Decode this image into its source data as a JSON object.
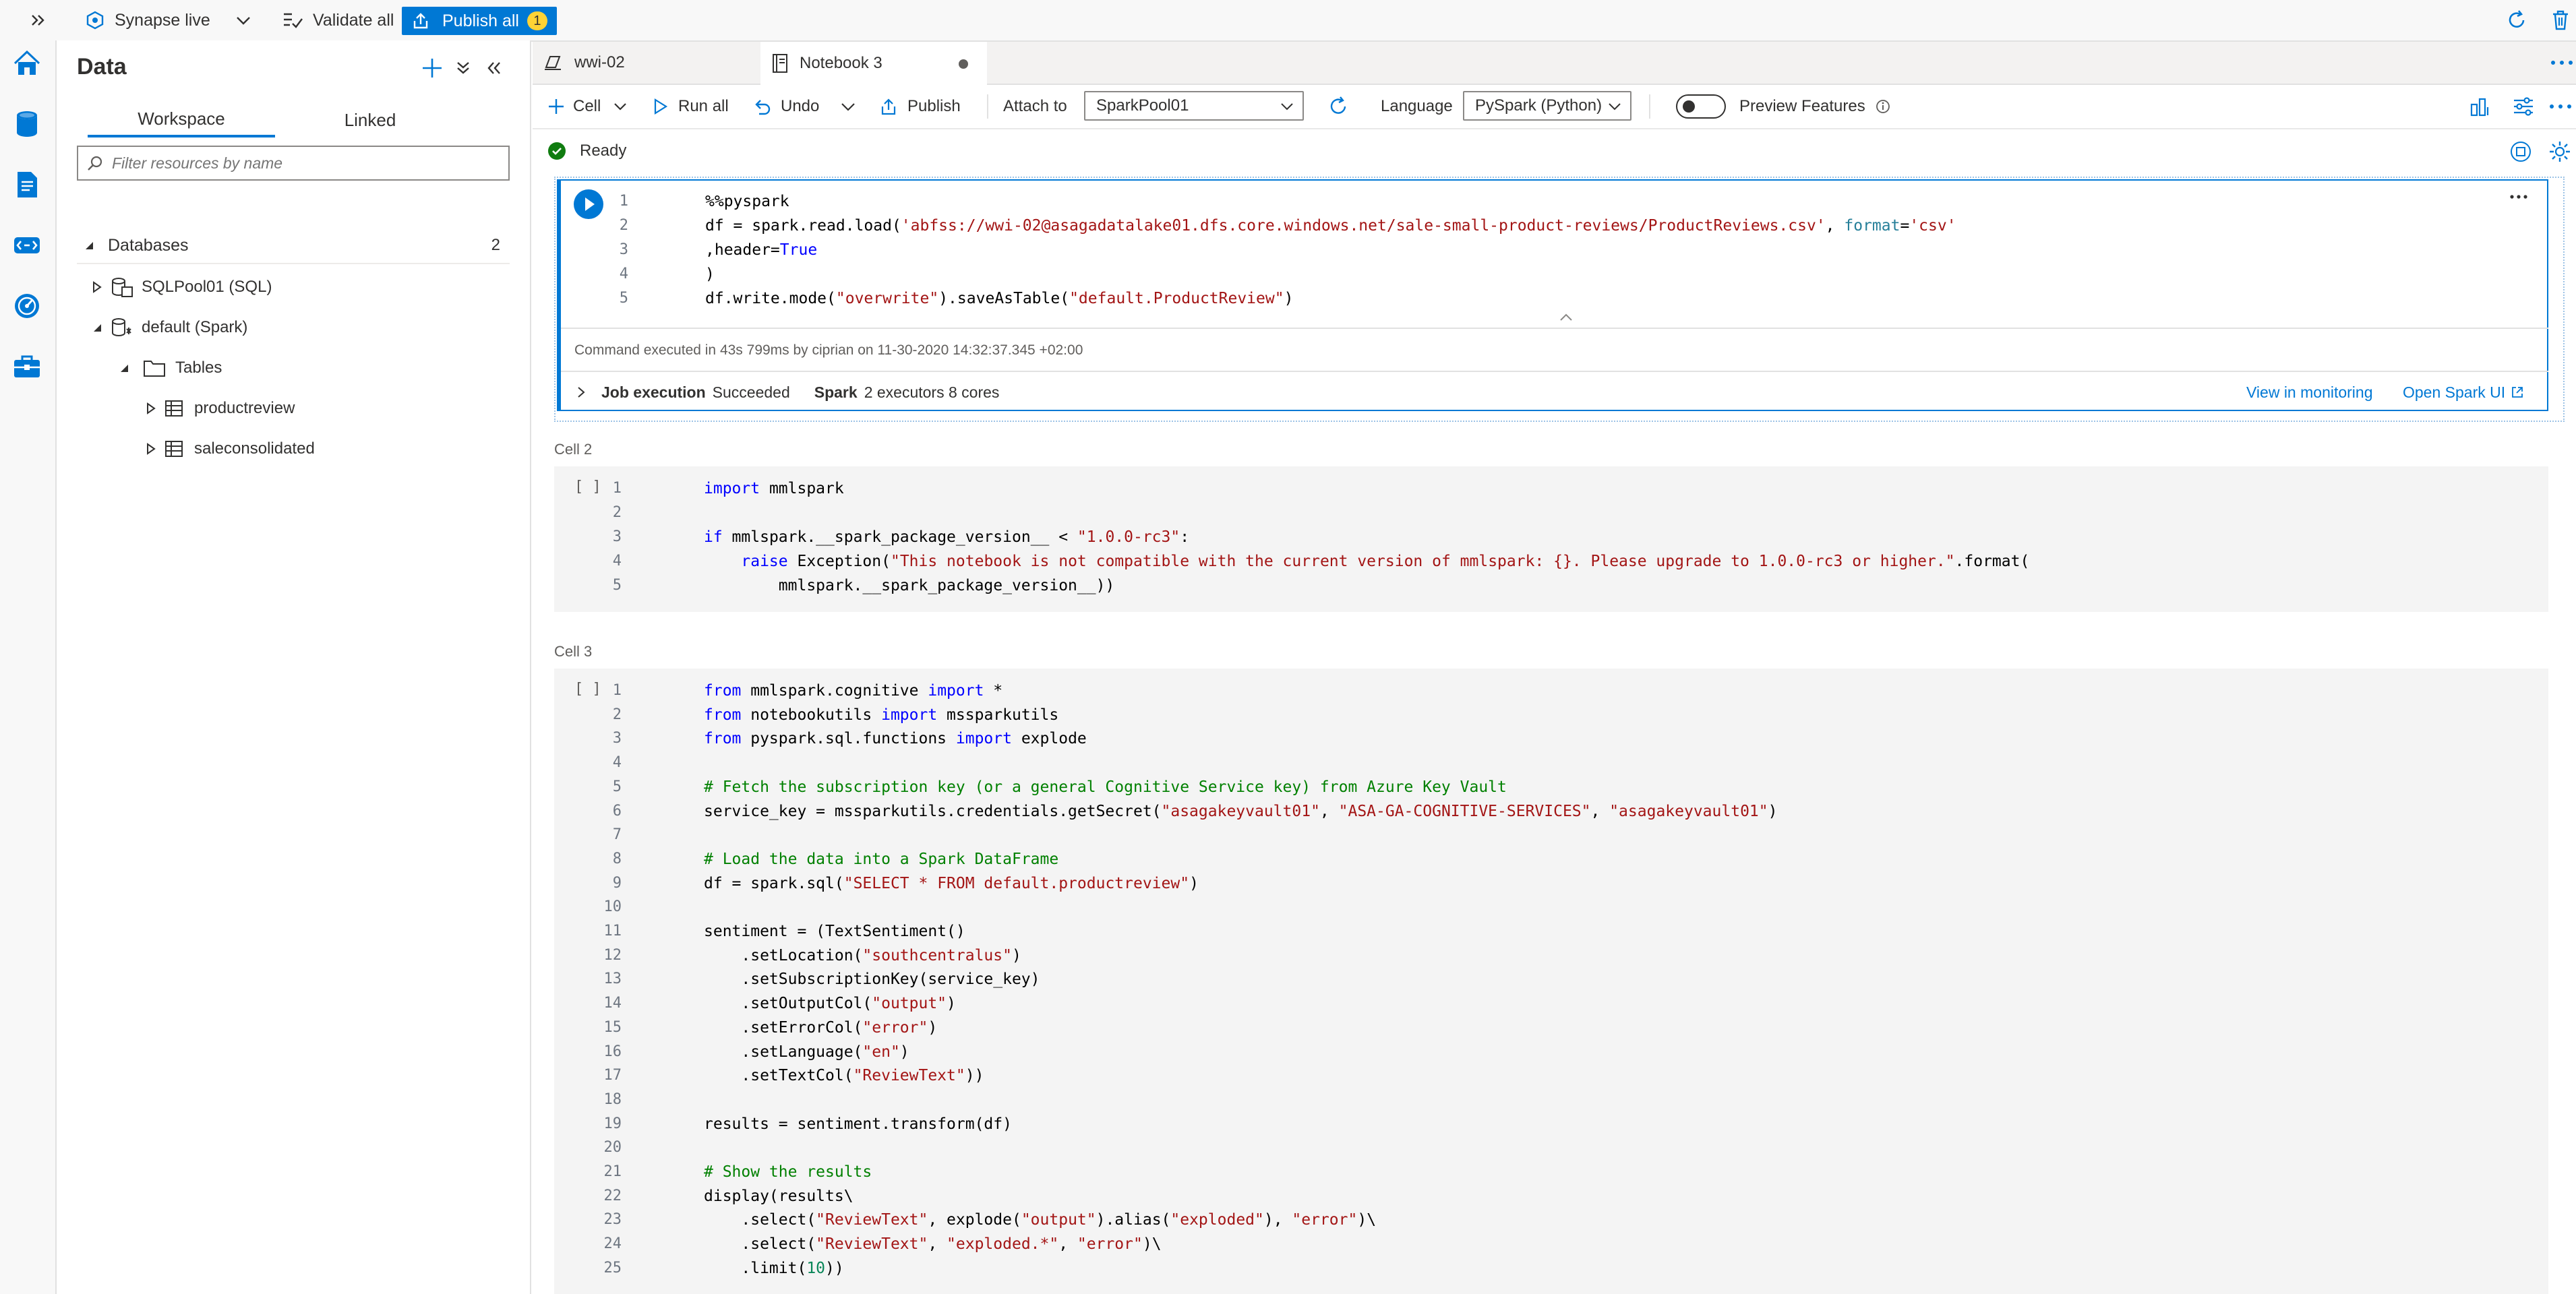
{
  "topbar": {
    "mode_label": "Synapse live",
    "validate_label": "Validate all",
    "publish_label": "Publish all",
    "publish_count": "1"
  },
  "data_panel": {
    "title": "Data",
    "tabs": [
      "Workspace",
      "Linked"
    ],
    "filter_placeholder": "Filter resources by name",
    "databases_label": "Databases",
    "databases_count": "2",
    "tree": [
      {
        "label": "SQLPool01 (SQL)"
      },
      {
        "label": "default (Spark)"
      },
      {
        "label": "Tables"
      },
      {
        "label": "productreview"
      },
      {
        "label": "saleconsolidated"
      }
    ]
  },
  "notebook": {
    "tabs": [
      {
        "label": "wwi-02"
      },
      {
        "label": "Notebook 3"
      }
    ],
    "toolbar": {
      "cell_label": "Cell",
      "run_all_label": "Run all",
      "undo_label": "Undo",
      "publish_label": "Publish",
      "attach_to_label": "Attach to",
      "attach_to_value": "SparkPool01",
      "language_label": "Language",
      "language_value": "PySpark (Python)",
      "preview_label": "Preview Features"
    },
    "status": "Ready",
    "cell1": {
      "lines": [
        "%%pyspark",
        "df = spark.read.load('abfss://wwi-02@asagadatalake01.dfs.core.windows.net/sale-small-product-reviews/ProductReviews.csv', format='csv'",
        ",header=True",
        ")",
        "df.write.mode(\"overwrite\").saveAsTable(\"default.ProductReview\")"
      ],
      "exec_info": "Command executed in 43s 799ms by ciprian on 11-30-2020 14:32:37.345 +02:00",
      "job_label": "Job execution",
      "job_status": "Succeeded",
      "spark_label": "Spark",
      "spark_info": "2 executors 8 cores",
      "view_monitoring": "View in monitoring",
      "open_spark_ui": "Open Spark UI"
    },
    "cell2": {
      "label": "Cell 2",
      "prompt": "[ ]",
      "lines": [
        "import mmlspark",
        "",
        "if mmlspark.__spark_package_version__ < \"1.0.0-rc3\":",
        "    raise Exception(\"This notebook is not compatible with the current version of mmlspark: {}. Please upgrade to 1.0.0-rc3 or higher.\".format(",
        "        mmlspark.__spark_package_version__))"
      ]
    },
    "cell3": {
      "label": "Cell 3",
      "prompt": "[ ]",
      "lines": [
        "from mmlspark.cognitive import *",
        "from notebookutils import mssparkutils",
        "from pyspark.sql.functions import explode",
        "",
        "# Fetch the subscription key (or a general Cognitive Service key) from Azure Key Vault",
        "service_key = mssparkutils.credentials.getSecret(\"asagakeyvault01\", \"ASA-GA-COGNITIVE-SERVICES\", \"asagakeyvault01\")",
        "",
        "# Load the data into a Spark DataFrame",
        "df = spark.sql(\"SELECT * FROM default.productreview\")",
        "",
        "sentiment = (TextSentiment()",
        "    .setLocation(\"southcentralus\")",
        "    .setSubscriptionKey(service_key)",
        "    .setOutputCol(\"output\")",
        "    .setErrorCol(\"error\")",
        "    .setLanguage(\"en\")",
        "    .setTextCol(\"ReviewText\"))",
        "",
        "results = sentiment.transform(df)",
        "",
        "# Show the results",
        "display(results\\",
        "    .select(\"ReviewText\", explode(\"output\").alias(\"exploded\"), \"error\")\\",
        "    .select(\"ReviewText\", \"exploded.*\", \"error\")\\",
        "    .limit(10))"
      ]
    }
  },
  "colors": {
    "accent": "#0078d4",
    "run_green": "#107c10",
    "keyword": "#0000ff",
    "string": "#a31515",
    "comment": "#008000"
  },
  "icons": {
    "rail": [
      "home-icon",
      "data-icon",
      "develop-icon",
      "integrate-icon",
      "monitor-icon",
      "manage-icon"
    ]
  }
}
